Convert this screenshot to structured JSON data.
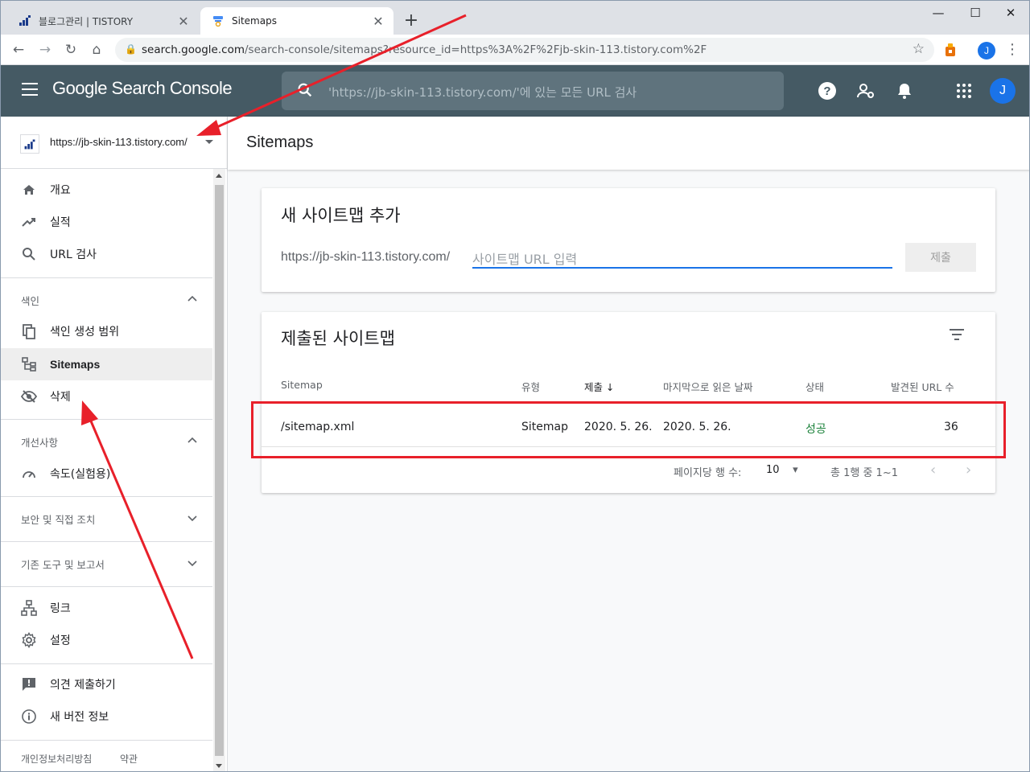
{
  "browser": {
    "tabs": [
      {
        "title": "블로그관리 | TISTORY",
        "favicon": "tistory-icon"
      },
      {
        "title": "Sitemaps",
        "favicon": "search-console-icon"
      }
    ],
    "address": {
      "domain": "search.google.com",
      "path": "/search-console/sitemaps?resource_id=https%3A%2F%2Fjb-skin-113.tistory.com%2F"
    },
    "profile_initial": "J"
  },
  "appbar": {
    "brand": "Google Search Console",
    "search_placeholder": "'https://jb-skin-113.tistory.com/'에 있는 모든 URL 검사",
    "avatar_initial": "J",
    "color": "#455a64"
  },
  "sidebar": {
    "property": "https://jb-skin-113.tistory.com/",
    "top_items": [
      {
        "label": "개요",
        "icon": "home-icon"
      },
      {
        "label": "실적",
        "icon": "trending-icon"
      },
      {
        "label": "URL 검사",
        "icon": "search-icon"
      }
    ],
    "index_section": {
      "title": "색인",
      "expanded": true,
      "items": [
        {
          "label": "색인 생성 범위",
          "icon": "copy-icon"
        },
        {
          "label": "Sitemaps",
          "icon": "sitemap-icon",
          "active": true
        },
        {
          "label": "삭제",
          "icon": "eye-off-icon"
        }
      ]
    },
    "enhance_section": {
      "title": "개선사항",
      "expanded": true,
      "items": [
        {
          "label": "속도(실험용)",
          "icon": "speed-icon"
        }
      ]
    },
    "security_section": {
      "title": "보안 및 직접 조치",
      "expanded": false
    },
    "legacy_section": {
      "title": "기존 도구 및 보고서",
      "expanded": false
    },
    "links_items": [
      {
        "label": "링크",
        "icon": "links-icon"
      },
      {
        "label": "설정",
        "icon": "gear-icon"
      }
    ],
    "help_items": [
      {
        "label": "의견 제출하기",
        "icon": "feedback-icon"
      },
      {
        "label": "새 버전 정보",
        "icon": "info-icon"
      }
    ],
    "footer": {
      "privacy": "개인정보처리방침",
      "terms": "약관"
    }
  },
  "main": {
    "page_title": "Sitemaps",
    "add_card": {
      "title": "새 사이트맵 추가",
      "prefix": "https://jb-skin-113.tistory.com/",
      "placeholder": "사이트맵 URL 입력",
      "submit_label": "제출"
    },
    "list_card": {
      "title": "제출된 사이트맵",
      "columns": {
        "sitemap": "Sitemap",
        "type": "유형",
        "submitted": "제출",
        "last_read": "마지막으로 읽은 날짜",
        "status": "상태",
        "discovered": "발견된 URL 수"
      },
      "rows": [
        {
          "sitemap": "/sitemap.xml",
          "type": "Sitemap",
          "submitted": "2020. 5. 26.",
          "last_read": "2020. 5. 26.",
          "status": "성공",
          "discovered": "36"
        }
      ],
      "pagination": {
        "rows_per_page_label": "페이지당 행 수:",
        "rows_per_page": "10",
        "range": "총 1행 중 1~1"
      }
    }
  },
  "annotation_color": "#e8202a"
}
